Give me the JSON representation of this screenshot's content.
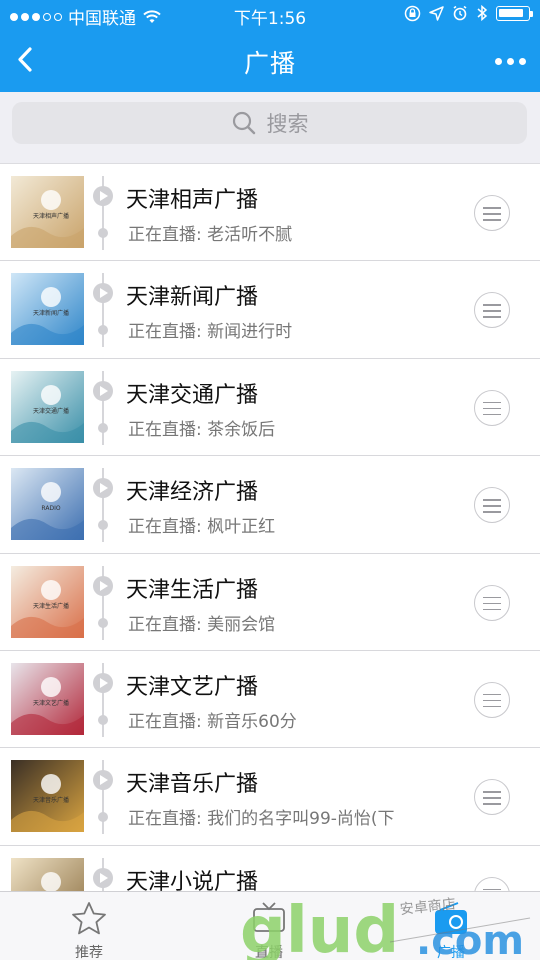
{
  "status_bar": {
    "carrier": "中国联通",
    "time": "下午1:56",
    "battery_level": 0.85
  },
  "nav": {
    "title": "广播",
    "back_icon": "chevron-left-icon",
    "more_icon": "more-dots-icon"
  },
  "search": {
    "placeholder": "搜索"
  },
  "stations": [
    {
      "name": "天津相声广播",
      "now_playing": "正在直播: 老活听不腻",
      "thumb_colors": [
        "#f2e9d6",
        "#c9a36a"
      ],
      "logo_text": "天津相声广播"
    },
    {
      "name": "天津新闻广播",
      "now_playing": "正在直播: 新闻进行时",
      "thumb_colors": [
        "#cfe6f7",
        "#2f86c9"
      ],
      "logo_text": "天津新闻广播"
    },
    {
      "name": "天津交通广播",
      "now_playing": "正在直播: 茶余饭后",
      "thumb_colors": [
        "#e6f2f3",
        "#3a8fa8"
      ],
      "logo_text": "天津交通广播"
    },
    {
      "name": "天津经济广播",
      "now_playing": "正在直播: 枫叶正红",
      "thumb_colors": [
        "#dbe7f3",
        "#3d6fb0"
      ],
      "logo_text": "RADIO"
    },
    {
      "name": "天津生活广播",
      "now_playing": "正在直播: 美丽会馆",
      "thumb_colors": [
        "#f4ece0",
        "#d9704a"
      ],
      "logo_text": "天津生活广播"
    },
    {
      "name": "天津文艺广播",
      "now_playing": "正在直播: 新音乐60分",
      "thumb_colors": [
        "#e8e4ea",
        "#b2283a"
      ],
      "logo_text": "天津文艺广播"
    },
    {
      "name": "天津音乐广播",
      "now_playing": "正在直播: 我们的名字叫99-尚怡(下",
      "thumb_colors": [
        "#3a2f25",
        "#d9a441"
      ],
      "logo_text": "天津音乐广播"
    },
    {
      "name": "天津小说广播",
      "now_playing": "",
      "thumb_colors": [
        "#efe2c6",
        "#8a6d3f"
      ],
      "logo_text": ""
    }
  ],
  "tabs": [
    {
      "label": "推荐",
      "icon": "star-icon",
      "active": false
    },
    {
      "label": "直播",
      "icon": "tv-icon",
      "active": false
    },
    {
      "label": "广播",
      "icon": "radio-icon",
      "active": true
    }
  ],
  "watermark": {
    "text": "glud.com",
    "tagline": "安卓商店"
  },
  "colors": {
    "primary": "#1a9bf0",
    "watermark_green": "#8dd16a",
    "watermark_blue": "#2a92e0"
  }
}
